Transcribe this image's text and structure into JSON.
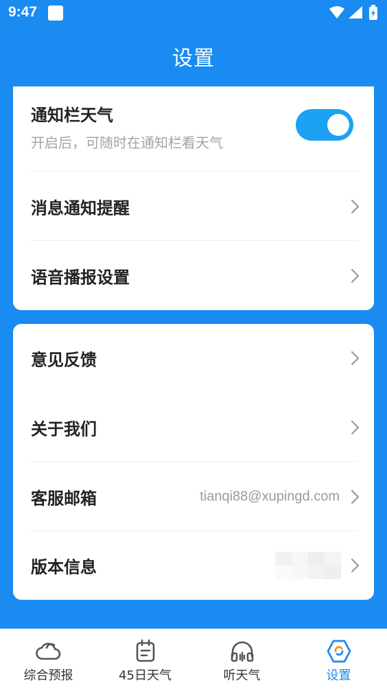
{
  "status_bar": {
    "time": "9:47"
  },
  "header": {
    "title": "设置"
  },
  "card1": {
    "notification": {
      "title": "通知栏天气",
      "subtitle": "开启后，可随时在通知栏看天气",
      "toggle_on": true
    },
    "items": [
      {
        "label": "消息通知提醒"
      },
      {
        "label": "语音播报设置"
      }
    ]
  },
  "card2": {
    "items": [
      {
        "label": "意见反馈"
      },
      {
        "label": "关于我们"
      },
      {
        "label": "客服邮箱",
        "value": "tianqi88@xupingd.com"
      },
      {
        "label": "版本信息"
      }
    ]
  },
  "bottom_nav": {
    "items": [
      {
        "label": "综合预报",
        "icon": "cloud-icon"
      },
      {
        "label": "45日天气",
        "icon": "calendar-icon"
      },
      {
        "label": "听天气",
        "icon": "headphones-icon"
      },
      {
        "label": "设置",
        "icon": "settings-icon"
      }
    ],
    "active_index": 3
  },
  "colors": {
    "primary": "#1a8bf0",
    "toggle": "#1da1f2"
  }
}
